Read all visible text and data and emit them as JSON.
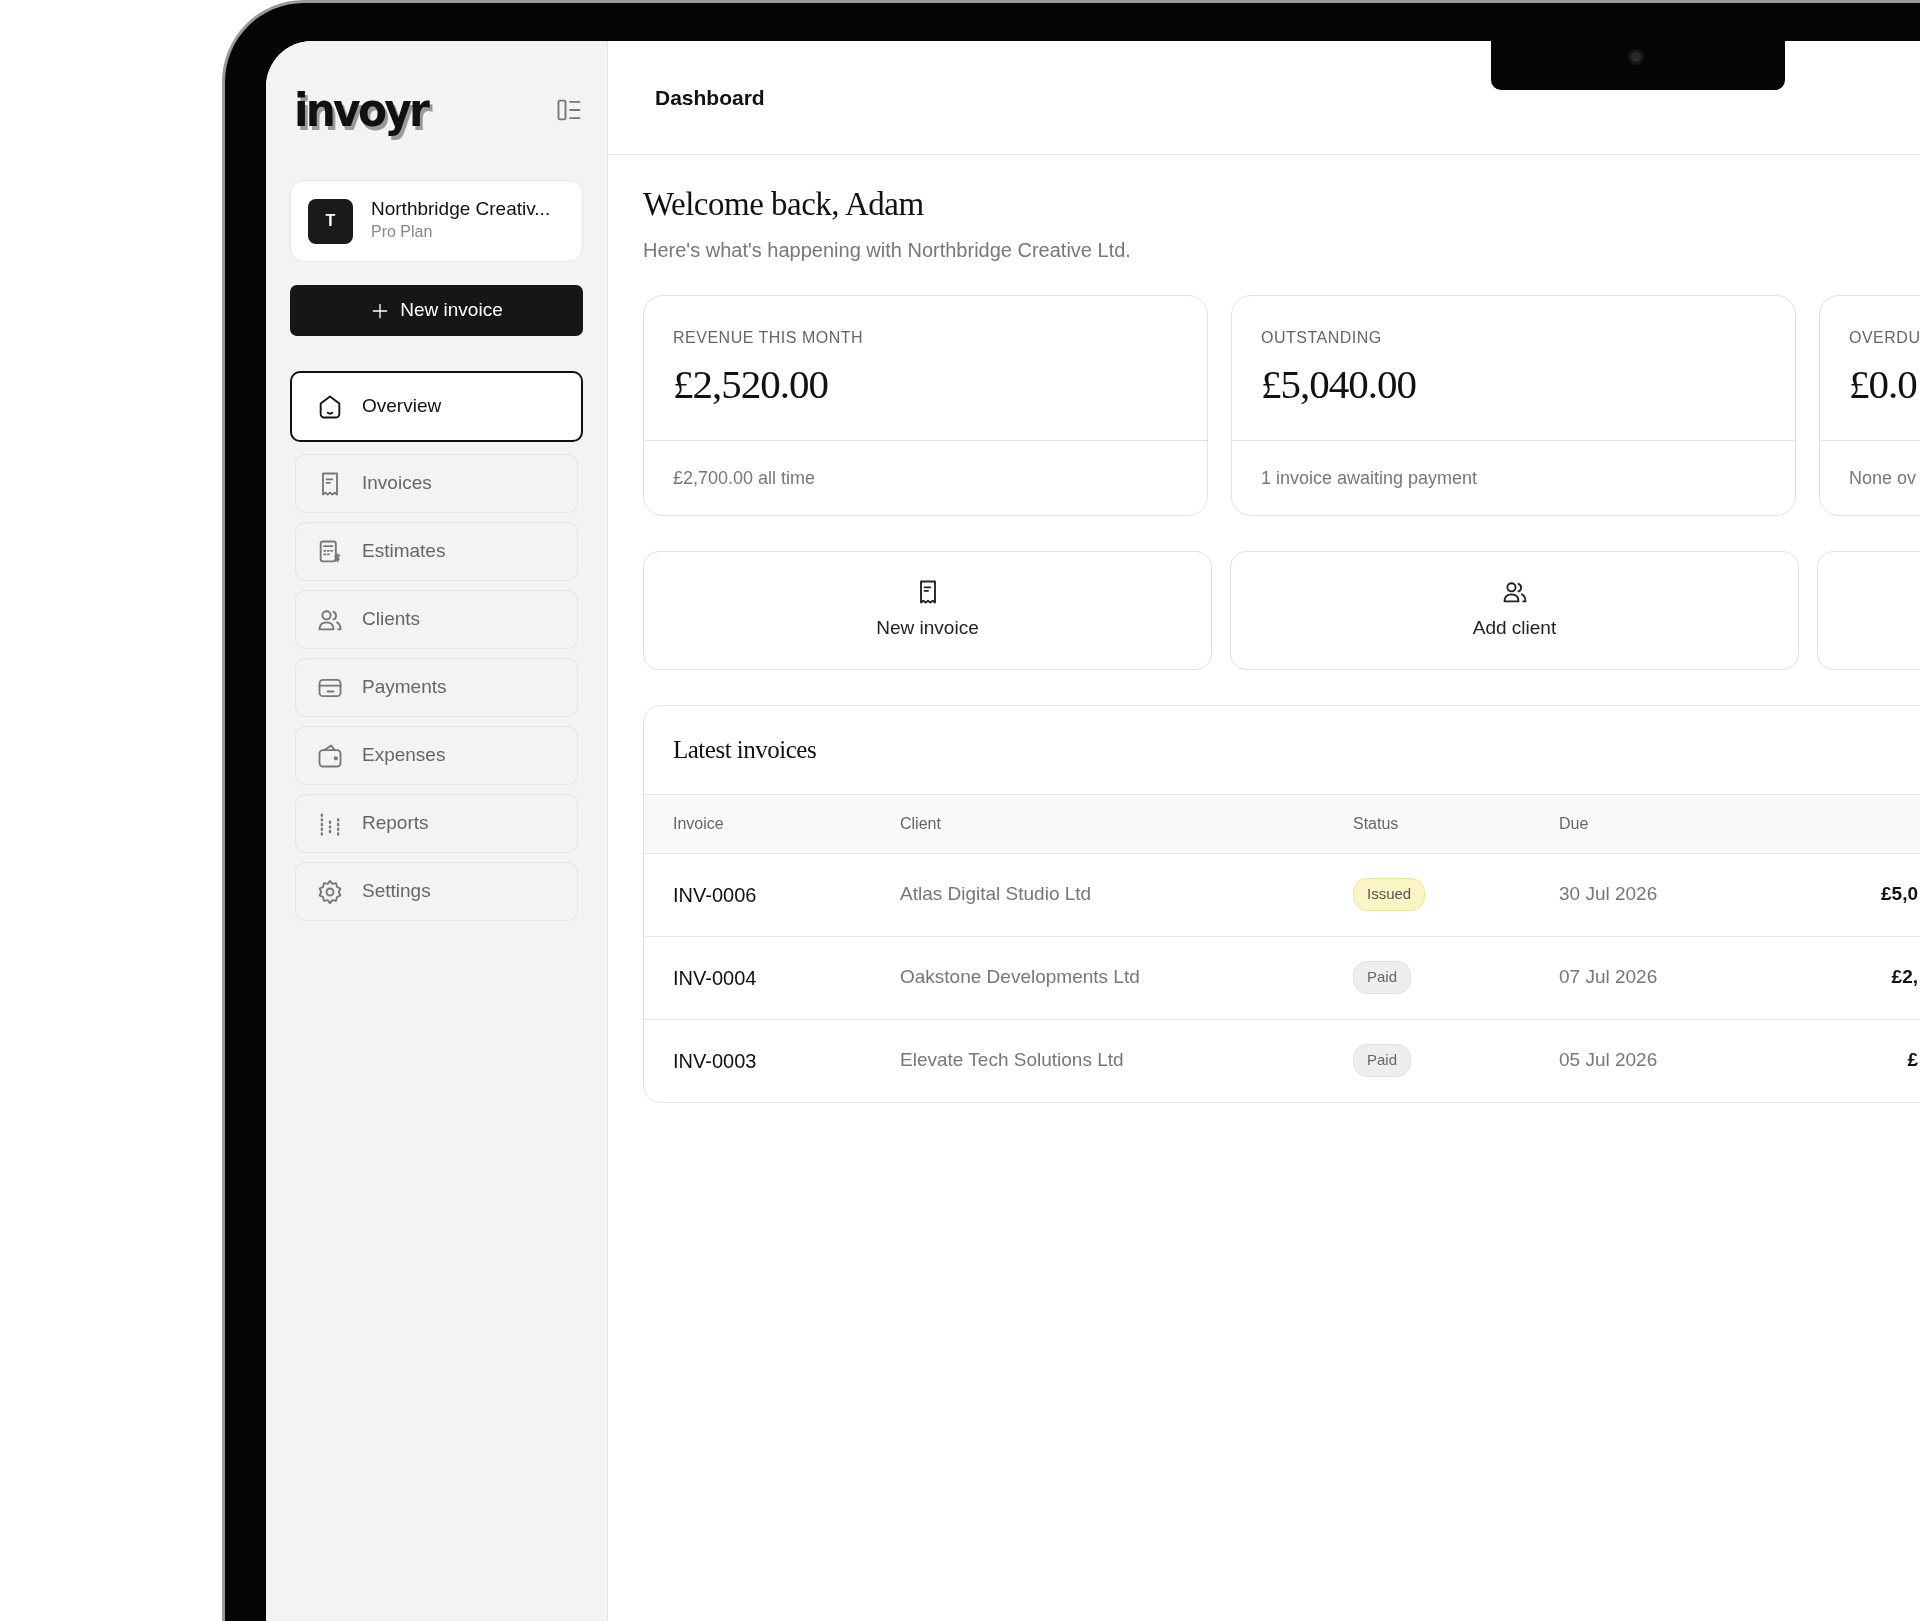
{
  "sidebar": {
    "logo": "invoyr",
    "organization": {
      "initial": "T",
      "name": "Northbridge Creativ...",
      "plan": "Pro Plan"
    },
    "new_button": {
      "label": "New invoice"
    },
    "items": [
      {
        "label": "Overview",
        "selected": true
      },
      {
        "label": "Invoices",
        "selected": false
      },
      {
        "label": "Estimates",
        "selected": false
      },
      {
        "label": "Clients",
        "selected": false
      },
      {
        "label": "Payments",
        "selected": false
      },
      {
        "label": "Expenses",
        "selected": false
      },
      {
        "label": "Reports",
        "selected": false
      },
      {
        "label": "Settings",
        "selected": false
      }
    ]
  },
  "header": {
    "title": "Dashboard"
  },
  "welcome": {
    "title": "Welcome back, Adam",
    "subtitle": "Here's what's happening with Northbridge Creative Ltd."
  },
  "stats": [
    {
      "label": "REVENUE THIS MONTH",
      "value": "£2,520.00",
      "note": "£2,700.00 all time"
    },
    {
      "label": "OUTSTANDING",
      "value": "£5,040.00",
      "note": "1 invoice awaiting payment"
    },
    {
      "label": "OVERDU",
      "value": "£0.0",
      "note": "None ov"
    }
  ],
  "quick_actions": [
    {
      "label": "New invoice"
    },
    {
      "label": "Add client"
    }
  ],
  "latest_invoices": {
    "title": "Latest invoices",
    "columns": [
      "Invoice",
      "Client",
      "Status",
      "Due"
    ],
    "rows": [
      {
        "invoice": "INV-0006",
        "client": "Atlas Digital Studio Ltd",
        "status": {
          "text": "Issued",
          "kind": "issued"
        },
        "due": "30 Jul 2026",
        "amount": "£5,0"
      },
      {
        "invoice": "INV-0004",
        "client": "Oakstone Developments Ltd",
        "status": {
          "text": "Paid",
          "kind": "paid"
        },
        "due": "07 Jul 2026",
        "amount": "£2,"
      },
      {
        "invoice": "INV-0003",
        "client": "Elevate Tech Solutions Ltd",
        "status": {
          "text": "Paid",
          "kind": "paid"
        },
        "due": "05 Jul 2026",
        "amount": "£"
      }
    ]
  }
}
